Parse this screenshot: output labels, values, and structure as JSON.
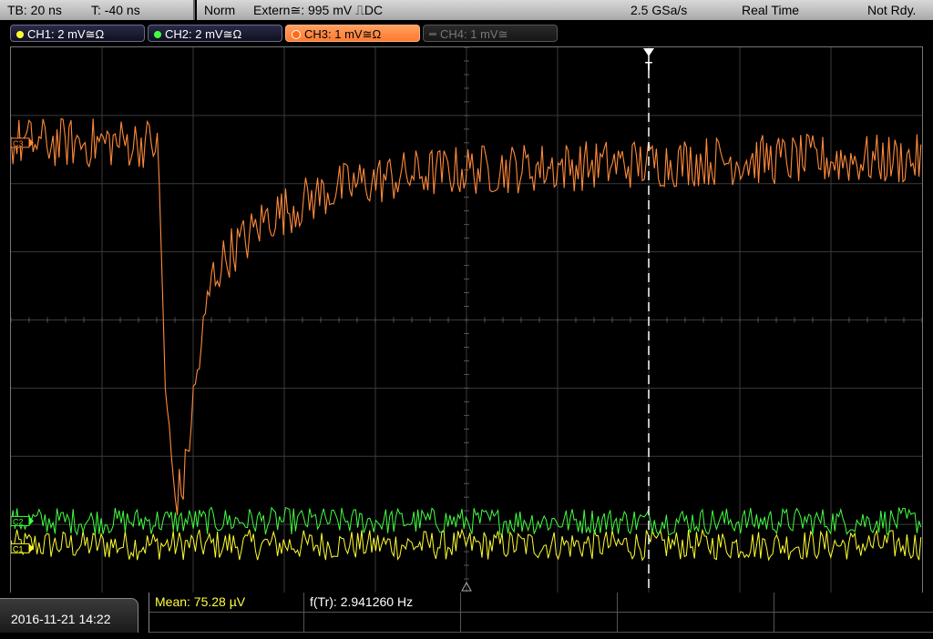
{
  "status": {
    "timebase": "TB: 20 ns",
    "trigger_time": "T: -40 ns",
    "trigger_mode": "Norm",
    "trigger_source": "Extern≅: 995 mV ⎍DC",
    "sample_rate": "2.5 GSa/s",
    "acq_mode": "Real Time",
    "run_state": "Not Rdy."
  },
  "channels": [
    {
      "label": "CH1: 2 mV≅Ω",
      "color": "#ffff30",
      "state": "on"
    },
    {
      "label": "CH2: 2 mV≅Ω",
      "color": "#40ff40",
      "state": "on"
    },
    {
      "label": "CH3: 1 mV≅Ω",
      "color": "#ff8a3a",
      "state": "active"
    },
    {
      "label": "CH4: 1 mV≅",
      "color": "#777777",
      "state": "off"
    }
  ],
  "markers": {
    "ch3": "C3",
    "ch2": "C2",
    "ch1": "C1",
    "trigger": "T"
  },
  "footer": {
    "datetime": "2016-11-21 14:22",
    "mean": "Mean: 75.28 µV",
    "freq": "f(Tr): 2.941260 Hz"
  },
  "chart_data": {
    "type": "line",
    "grid": {
      "x_divisions": 10,
      "y_divisions": 8
    },
    "x_unit_per_div": "20 ns",
    "series": [
      {
        "name": "CH3",
        "color": "#ff8a3a",
        "x_div": [
          0,
          1.6,
          1.62,
          1.65,
          1.7,
          1.8,
          1.9,
          2.0,
          2.1,
          2.2,
          2.4,
          2.6,
          2.8,
          3.0,
          3.5,
          4.0,
          4.5,
          5.0,
          6.0,
          7.0,
          8.0,
          10.0
        ],
        "y_div": [
          2.6,
          2.6,
          2.2,
          1.0,
          -1.2,
          -2.6,
          -2.4,
          -1.2,
          -0.3,
          0.6,
          1.0,
          1.2,
          1.5,
          1.6,
          1.9,
          2.05,
          2.15,
          2.2,
          2.25,
          2.3,
          2.35,
          2.35
        ]
      },
      {
        "name": "CH2",
        "color": "#40ff40",
        "level_div": -2.95
      },
      {
        "name": "CH1",
        "color": "#ffff30",
        "level_div": -3.3
      }
    ]
  }
}
